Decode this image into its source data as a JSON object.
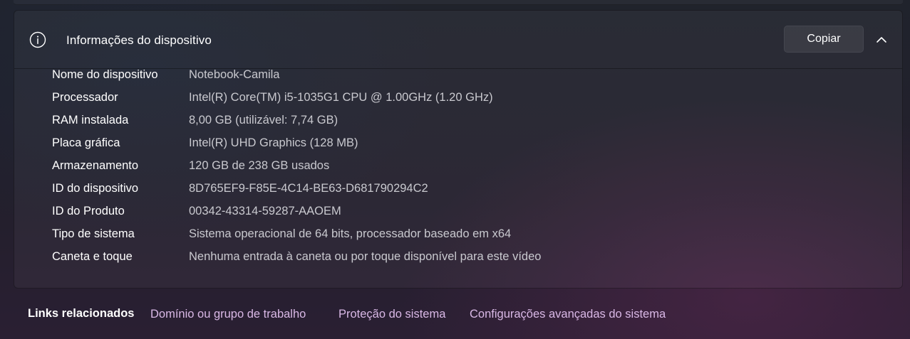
{
  "device_info": {
    "title": "Informações do dispositivo",
    "copy_label": "Copiar",
    "specs": [
      {
        "label": "Nome do dispositivo",
        "value": "Notebook-Camila"
      },
      {
        "label": "Processador",
        "value": "Intel(R) Core(TM) i5-1035G1 CPU @ 1.00GHz (1.20 GHz)"
      },
      {
        "label": "RAM instalada",
        "value": "8,00 GB (utilizável: 7,74 GB)"
      },
      {
        "label": "Placa gráfica",
        "value": "Intel(R) UHD Graphics (128 MB)"
      },
      {
        "label": "Armazenamento",
        "value": "120 GB de 238 GB usados"
      },
      {
        "label": "ID do dispositivo",
        "value": "8D765EF9-F85E-4C14-BE63-D681790294C2"
      },
      {
        "label": "ID do Produto",
        "value": "00342-43314-59287-AAOEM"
      },
      {
        "label": "Tipo de sistema",
        "value": "Sistema operacional de 64 bits, processador baseado em x64"
      },
      {
        "label": "Caneta e toque",
        "value": "Nenhuma entrada à caneta ou por toque disponível para este vídeo"
      }
    ]
  },
  "related_links": {
    "title": "Links relacionados",
    "links": [
      "Domínio ou grupo de trabalho",
      "Proteção do sistema",
      "Configurações avançadas do sistema"
    ]
  },
  "icons": {
    "info": "info-icon",
    "collapse": "chevron-up-icon"
  },
  "colors": {
    "link": "#d9b8e6",
    "value_text": "#c9c9cf",
    "label_text": "#ffffff"
  }
}
